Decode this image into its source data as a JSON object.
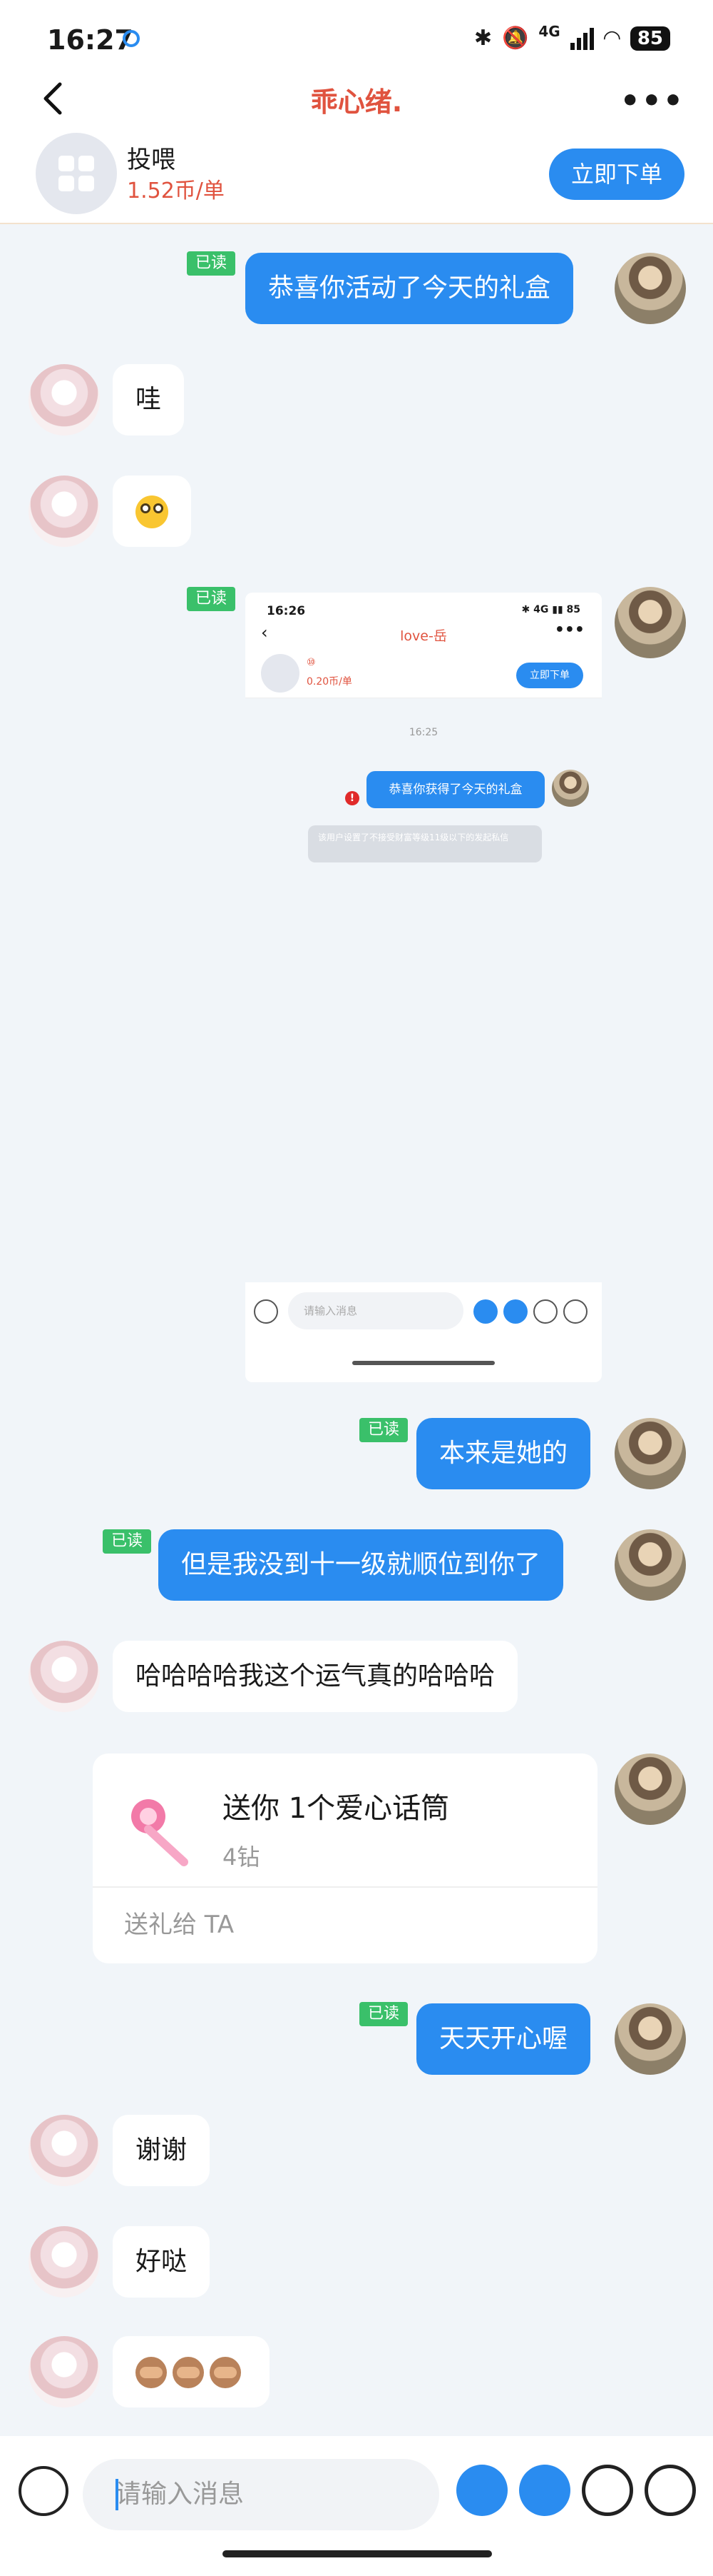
{
  "status_bar": {
    "time": "16:27",
    "network": "4G",
    "battery": "85"
  },
  "header": {
    "title": "乖心绪."
  },
  "service": {
    "name": "投喂",
    "price": "1.52币/单",
    "order_button": "立即下单"
  },
  "messages": {
    "read_label": "已读",
    "m1": "恭喜你活动了今天的礼盒",
    "m2": "哇",
    "m5": "本来是她的",
    "m6": "但是我没到十一级就顺位到你了",
    "m7": "哈哈哈哈我这个运气真的哈哈哈",
    "m9": "天天开心喔",
    "m10": "谢谢",
    "m11": "好哒"
  },
  "screenshot": {
    "time": "16:26",
    "network": "4G",
    "battery": "85",
    "title": "love-岳",
    "service_name": "⑩",
    "price": "0.20币/单",
    "order_button": "立即下单",
    "chat_time": "16:25",
    "bubble": "恭喜你获得了今天的礼盒",
    "error_mark": "!",
    "system_note": "该用户设置了不接受财富等级11级以下的发起私信",
    "input_placeholder": "请输入消息"
  },
  "gift": {
    "title": "送你 1个爱心话筒",
    "price": "4钻",
    "action": "送礼给 TA"
  },
  "input": {
    "placeholder": "请输入消息"
  },
  "icons": [
    "back-arrow-icon",
    "more-icon",
    "app-grid-icon",
    "flushed-face-emoji",
    "see-no-evil-monkey-emoji",
    "voice-icon",
    "gift-icon",
    "red-packet-icon",
    "emoji-icon",
    "plus-icon",
    "mic-wand-icon"
  ],
  "colors": {
    "accent_blue": "#2a8cf0",
    "title_red": "#e0533f",
    "read_green": "#3ac06a",
    "background": "#f1f5f9"
  }
}
